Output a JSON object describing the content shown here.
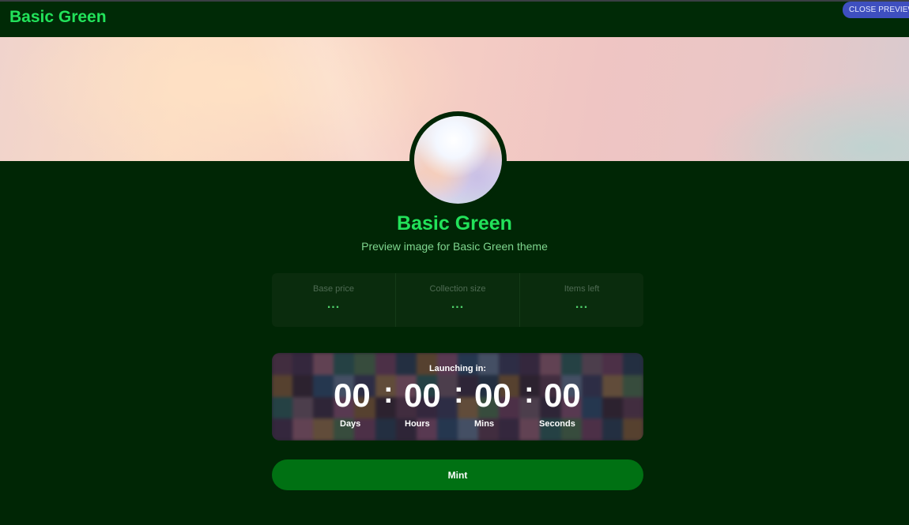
{
  "header": {
    "brand": "Basic Green",
    "close_preview": "CLOSE PREVIEW"
  },
  "collection": {
    "title": "Basic Green",
    "subtitle": "Preview image for Basic Green theme"
  },
  "stats": [
    {
      "label": "Base price",
      "value": "..."
    },
    {
      "label": "Collection size",
      "value": "..."
    },
    {
      "label": "Items left",
      "value": "..."
    }
  ],
  "countdown": {
    "label": "Launching in:",
    "days": "00",
    "hours": "00",
    "mins": "00",
    "seconds": "00",
    "separator": ":",
    "days_label": "Days",
    "hours_label": "Hours",
    "mins_label": "Mins",
    "seconds_label": "Seconds"
  },
  "mint_button": {
    "label": "Mint"
  },
  "colors": {
    "background": "#002605",
    "accent": "#22e25a",
    "button": "#007113",
    "close_preview": "#3e4fbf"
  }
}
